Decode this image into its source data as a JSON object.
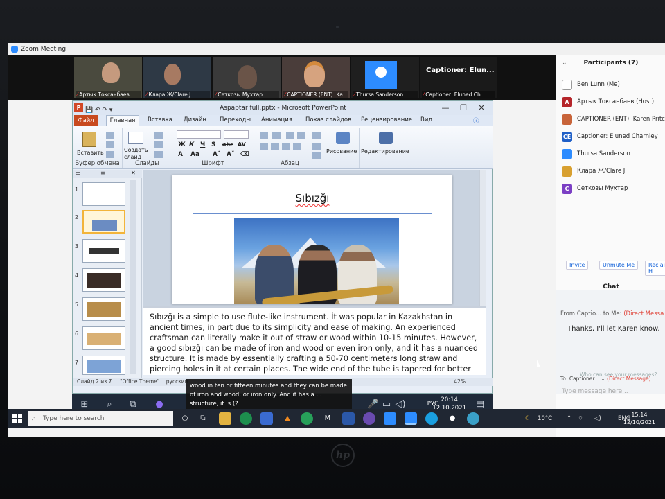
{
  "zoom": {
    "window_title": "Zoom Meeting",
    "videos": [
      {
        "name": "Артык Токсанбаев"
      },
      {
        "name": "Клара Ж/Clare J"
      },
      {
        "name": "Сеткозы Мухтар"
      },
      {
        "name": "CAPTIONER (ENT): Ka..."
      },
      {
        "name": "Thursa Sanderson"
      },
      {
        "name": "Captioner: Eluned Ch..."
      }
    ],
    "captioner_big": "Captioner: Elun...",
    "participants_header": "Participants (7)",
    "participants": [
      {
        "name": "Ben Lunn (Me)",
        "initials": "",
        "color": "#cccccc"
      },
      {
        "name": "Артык Токсанбаев (Host)",
        "initials": "A",
        "color": "#b5252a"
      },
      {
        "name": "CAPTIONER (ENT): Karen Pritchard",
        "initials": "",
        "color": "#c8643a"
      },
      {
        "name": "Captioner: Eluned Charnley",
        "initials": "CE",
        "color": "#1f5fc7"
      },
      {
        "name": "Thursa Sanderson",
        "initials": "",
        "color": "#2d8cff"
      },
      {
        "name": "Клара Ж/Clare J",
        "initials": "",
        "color": "#d8a030"
      },
      {
        "name": "Сеткозы Мухтар",
        "initials": "C",
        "color": "#7b3fc4"
      }
    ],
    "buttons": {
      "invite": "Invite",
      "unmute": "Unmute Me",
      "reclaim": "Reclaim H"
    },
    "chat_header": "Chat",
    "chat_from": "From Captio... to Me:",
    "chat_from_dm": "(Direct Messa",
    "chat_message": "Thanks, I'll let Karen know.",
    "chat_ask": "Who can see your messages?",
    "to_label": "To:",
    "to_value": "Captioner...",
    "to_dm": "(Direct Message)",
    "type_placeholder": "Type message here..."
  },
  "powerpoint": {
    "title": "Aspaptar full.pptx - Microsoft PowerPoint",
    "tabs": [
      "Файл",
      "Главная",
      "Вставка",
      "Дизайн",
      "Переходы",
      "Анимация",
      "Показ слайдов",
      "Рецензирование",
      "Вид"
    ],
    "groups": {
      "clipboard": "Буфер обмена",
      "slides": "Слайды",
      "font": "Шрифт",
      "paragraph": "Абзац",
      "insert": "Вставить",
      "create_slide": "Создать слайд",
      "drawing": "Рисование",
      "editing": "Редактирование"
    },
    "slide_numbers": [
      "1",
      "2",
      "3",
      "4",
      "5",
      "6",
      "7"
    ],
    "slide_title": "Sıbızğı",
    "notes_text": "Sıbızğı is a simple to use flute-like instrument. İt was popular in Kazakhstan in ancient times, in part due to its simplicity and ease of making. An experienced craftsman can literally make it out of straw or wood within 10-15 minutes. However, a good sıbızğı can be made of iron and wood or even iron only, and it has a nuanced structure. It is made by essentially crafting a 50-70 centimeters long straw and piercing holes in it at certain places. The wide end of the tube is tapered for better air propagation. There are different kinds of sıbızğı that are tuned from note small octave to the second octave",
    "status_slide": "Слайд 2 из 7",
    "status_theme": "\"Office Theme\"",
    "status_lang": "русский",
    "zoom_level": "42%"
  },
  "remote_taskbar": {
    "lang": "РУС",
    "time": "20:14",
    "date": "12.10.2021"
  },
  "caption": "wood in ten or fifteen minutes and they can be made of iron and wood, or iron only. And it has a ... structure, it is (?",
  "taskbar": {
    "search_placeholder": "Type here to search",
    "weather": "10°C",
    "lang": "ENG",
    "time": "15:14",
    "date": "12/10/2021"
  }
}
